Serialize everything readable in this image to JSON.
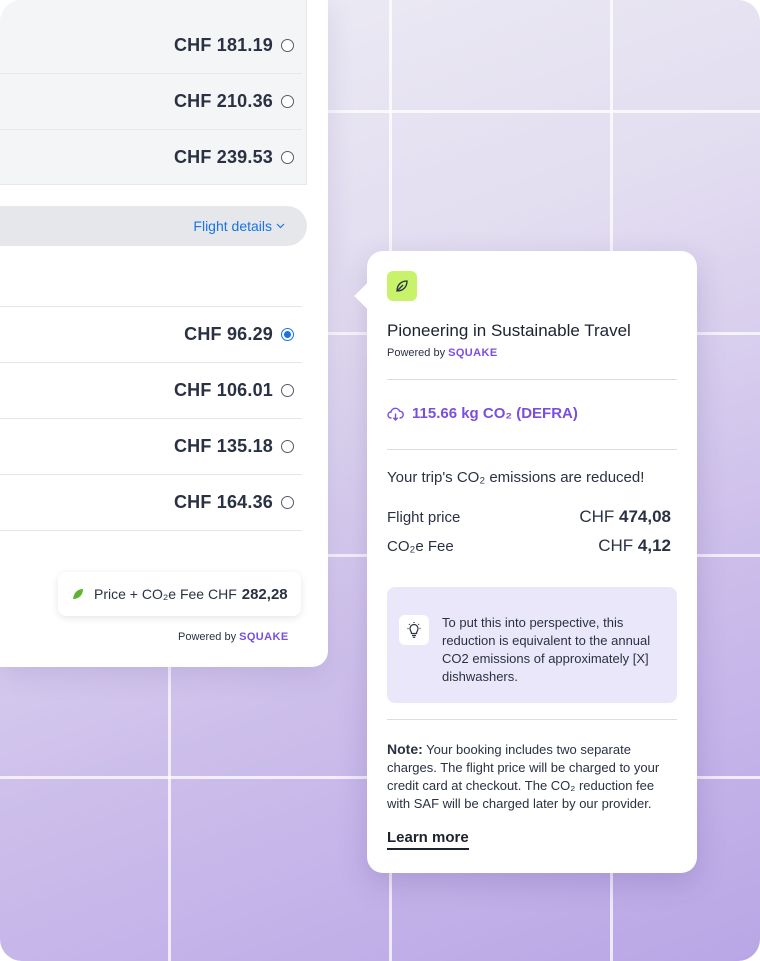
{
  "upper_options": [
    {
      "price": "CHF 181.19",
      "selected": false
    },
    {
      "price": "CHF 210.36",
      "selected": false
    },
    {
      "price": "CHF 239.53",
      "selected": false
    }
  ],
  "flight_details_label": "Flight details",
  "lower_options": [
    {
      "price": "CHF 96.29",
      "selected": true
    },
    {
      "price": "CHF 106.01",
      "selected": false
    },
    {
      "price": "CHF 135.18",
      "selected": false
    },
    {
      "price": "CHF 164.36",
      "selected": false
    }
  ],
  "fee_box": {
    "label": "Price + CO₂e Fee CHF",
    "amount": "282,28"
  },
  "powered_by": {
    "prefix": "Powered by",
    "brand": "SQUAKE"
  },
  "popup": {
    "title": "Pioneering in Sustainable Travel",
    "emissions": "115.66 kg CO₂ (DEFRA)",
    "reduced_text": "Your trip's CO₂ emissions are reduced!",
    "flight_price_label": "Flight price",
    "flight_price_currency": "CHF",
    "flight_price_value": "474,08",
    "fee_label": "CO₂e Fee",
    "fee_currency": "CHF",
    "fee_value": "4,12",
    "perspective_text": "To put this into perspective, this reduction is equivalent to the annual CO2 emissions of approximately [X] dishwashers.",
    "note_label": "Note:",
    "note_text": "Your booking includes two separate charges. The flight price will be charged to your credit card at checkout. The CO₂ reduction fee with SAF will be charged later by our provider.",
    "learn_more": "Learn more"
  },
  "colors": {
    "accent": "#7a4fe0",
    "link": "#1a73e8",
    "leaf_tile": "#c8f26a"
  }
}
